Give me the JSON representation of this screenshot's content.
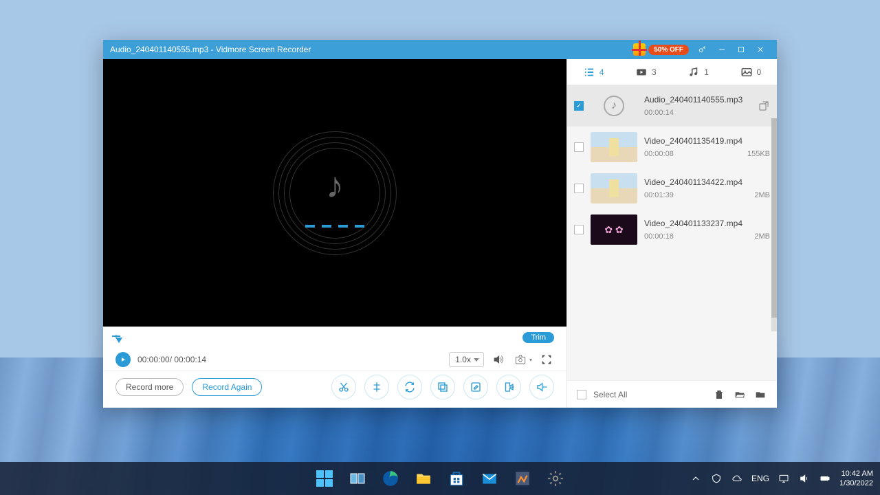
{
  "window": {
    "title": "Audio_240401140555.mp3  -  Vidmore Screen Recorder",
    "promo_text": "50% OFF"
  },
  "filters": {
    "all": "4",
    "video": "3",
    "audio": "1",
    "image": "0"
  },
  "recordings": [
    {
      "name": "Audio_240401140555.mp3",
      "duration": "00:00:14",
      "size": "",
      "checked": true,
      "thumb": "audio"
    },
    {
      "name": "Video_240401135419.mp4",
      "duration": "00:00:08",
      "size": "155KB",
      "checked": false,
      "thumb": "v1"
    },
    {
      "name": "Video_240401134422.mp4",
      "duration": "00:01:39",
      "size": "2MB",
      "checked": false,
      "thumb": "v1"
    },
    {
      "name": "Video_240401133237.mp4",
      "duration": "00:00:18",
      "size": "2MB",
      "checked": false,
      "thumb": "v2"
    }
  ],
  "player": {
    "trim_label": "Trim",
    "time_display": "00:00:00/ 00:00:14",
    "speed": "1.0x",
    "record_more": "Record more",
    "record_again": "Record Again"
  },
  "list_controls": {
    "select_all": "Select All"
  },
  "taskbar": {
    "lang": "ENG",
    "time": "10:42 AM",
    "date": "1/30/2022"
  }
}
